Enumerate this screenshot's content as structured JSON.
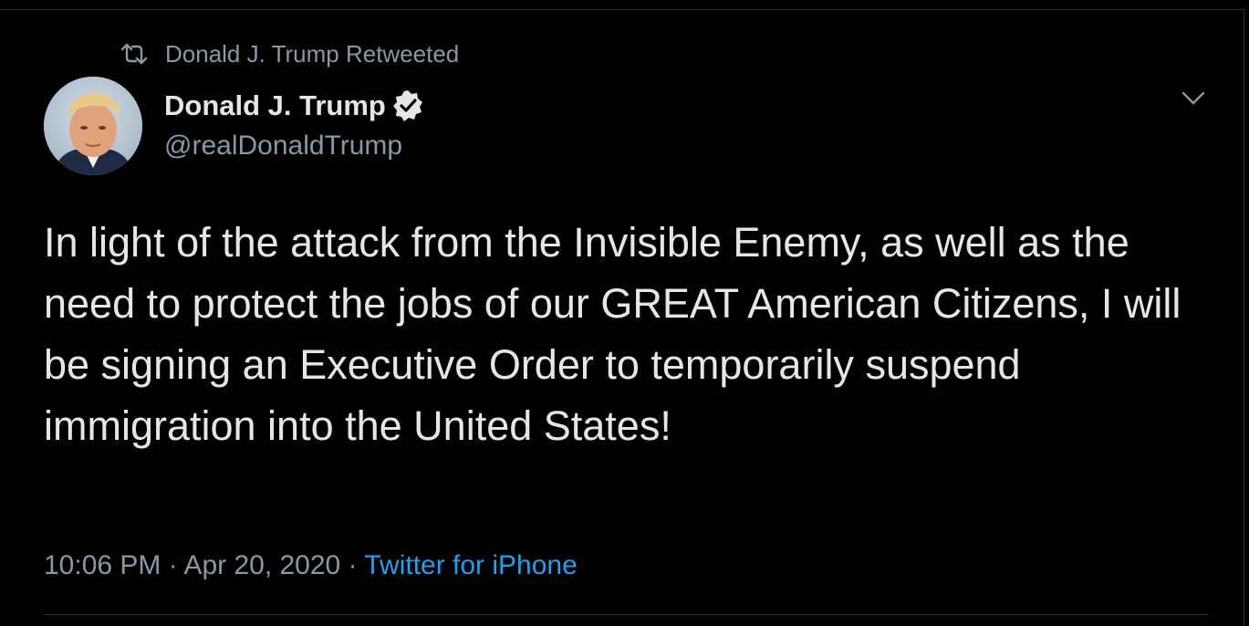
{
  "retweet": {
    "icon": "retweet-icon",
    "label": "Donald J. Trump Retweeted"
  },
  "author": {
    "name": "Donald J. Trump",
    "handle": "@realDonaldTrump",
    "verified": true,
    "verified_icon": "verified-badge-icon",
    "avatar": "avatar-photo"
  },
  "menu": {
    "icon": "chevron-down-icon"
  },
  "tweet": {
    "text": "In light of the attack from the Invisible Enemy, as well as the need to protect the jobs of our GREAT American Citizens, I will be signing an Executive Order to temporarily suspend immigration into the United States!"
  },
  "meta": {
    "time": "10:06 PM",
    "separator": " · ",
    "date": "Apr 20, 2020",
    "source": "Twitter for iPhone"
  },
  "colors": {
    "background": "#000000",
    "text": "#e6e6e6",
    "secondary": "#8899a6",
    "link": "#1da1f2",
    "border": "#2f3336"
  }
}
